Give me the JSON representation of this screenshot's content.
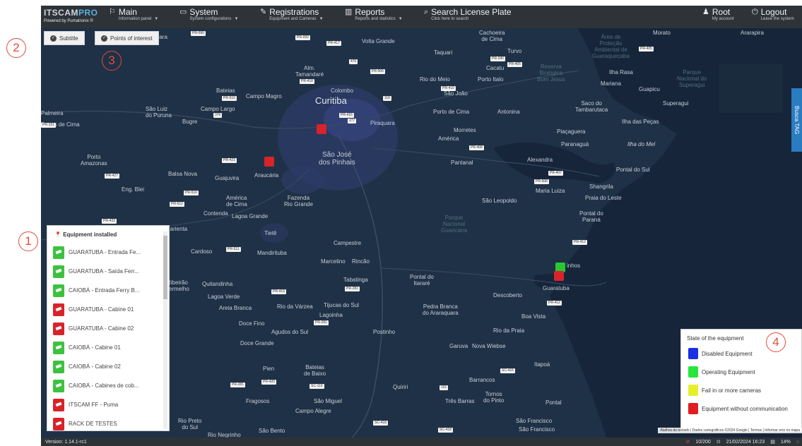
{
  "nav": {
    "brand_logo_a": "ITSCAM",
    "brand_logo_b": "PRO",
    "brand_powered": "Powered by Pumatronix ®",
    "main": {
      "title": "Main",
      "subtitle": "Information panel"
    },
    "system": {
      "title": "System",
      "subtitle": "System configurations"
    },
    "registrations": {
      "title": "Registrations",
      "subtitle": "Equipment and Cameras"
    },
    "reports": {
      "title": "Reports",
      "subtitle": "Reports and statistics"
    },
    "search": {
      "title": "Search License Plate",
      "subtitle": "Click here to search"
    },
    "account": {
      "title": "Root",
      "subtitle": "My account"
    },
    "logout": {
      "title": "Logout",
      "subtitle": "Leave the system"
    }
  },
  "map_controls": {
    "subtitle": "Subtitle",
    "points_of_interest": "Points of interest",
    "busca_tag": "Busca TAG"
  },
  "map_labels": {
    "curitiba": "Curitiba",
    "sao_jose": "São José\ndos Pinhais",
    "taquara": "Taquara",
    "colombo": "Colombo",
    "campo_magro": "Campo Magro",
    "almirante": "Alm.\nTamandaré",
    "bateias": "Bateias",
    "palmeira": "Palmeira",
    "pugas": "Pugas de Cima",
    "sao_luiz": "São Luiz\ndo Puruna",
    "campo_largo": "Campo Largo",
    "bugre": "Bugre",
    "porto_amazonas": "Porto\nAmazonas",
    "eng_blei": "Eng. Blei",
    "balsa_nova": "Balsa Nova",
    "guajuvira": "Guajuvira",
    "araucaria": "Araucária",
    "america": "América\nde Cima",
    "contenda": "Contenda",
    "lagoa_grande": "Lagoa Grande",
    "fazenda": "Fazenda\nRio Grande",
    "tiete": "Tietê",
    "mandirituba": "Mandirituba",
    "cardoso": "Cardoso",
    "campestre": "Campestre",
    "marcelino": "Marcelino",
    "rincao": "Rincão",
    "tabatinga": "Tabatinga",
    "pontal_itarare": "Pontal do\nItararé",
    "ribeirao": "Ribeirão\nVermelho",
    "quitandinha": "Quitandinha",
    "lagoa_verde": "Lagoa Verde",
    "areia_branca": "Areia Branca",
    "rio_varzea": "Rio da Várzea",
    "tijucas": "Tijucas do Sul",
    "lagoinha": "Lagoinha",
    "pedra_branca": "Pedra Branca\ndo Araraquara",
    "doce_fino": "Doce Fino",
    "agudos": "Agudos do Sul",
    "postinho": "Postinho",
    "doce_grande": "Doce Grande",
    "piraquara": "Piraquara",
    "quatro_barras": "Rio do Meio",
    "tapera": "Porto Italo",
    "cacatu": "Cacatu",
    "sao_joao": "São João",
    "porto_de_cima": "Porto de Cima",
    "antonina": "Antonina",
    "morretes": "Morretes",
    "america2": "América",
    "pantanal": "Pantanal",
    "alexandra": "Alexandra",
    "maria_luiza": "Maria Luiza",
    "sao_leopoldo": "São Leopoldo",
    "paranagua": "Paranaguá",
    "pontal_sul": "Pontal do Sul",
    "shangrila": "Shangrila",
    "praia_leste": "Praia do Leste",
    "pontal_parana": "Pontal do\nParaná",
    "guaratuba": "Guaratuba",
    "caiobá": "inhos",
    "descoberto": "Descoberto",
    "boa_vista": "Boa Vista",
    "rio_da_praia": "Rio da Praia",
    "garuva": "Garuva",
    "nova_wiebse": "Nova Wiebse",
    "itapoa": "Itapoá",
    "barrancos": "Barrancos",
    "quirin": "Quiriri",
    "pirai": "Pien",
    "bateias2": "Bateias\nde Baixo",
    "fragosos": "Fragosos",
    "sao_miguel": "São Miguel",
    "campo_alegre": "Campo Alegre",
    "tres_barras": "Três Barras",
    "tornos": "Tornos\ndo Pinto",
    "pontal": "Pontal",
    "sao_francisco": "São Francisco",
    "sao_francisco2": "São Francisco",
    "rio_preto": "Rio Preto\ndo Sul",
    "sao_bento": "São Bento",
    "rio_negrinho": "Rio Negrinho",
    "turvo": "Turvo",
    "taquari": "Taquari",
    "cachoeira": "Cachoeira\nde Cima",
    "morato": "Morato",
    "ararapira": "Ararapira",
    "volta_grande": "Volta Grande",
    "ilha_rasa": "Ilha Rasa",
    "mariana": "Mariana",
    "guapicu": "Guapicu",
    "superagui": "Superagui",
    "saco": "Saco do\nTambarutaca",
    "ilha_pecas": "Ilha das Peças",
    "piacaguera": "Piaçaguera",
    "ilha_mel": "Ilha do Mel",
    "pinhais": "Marienta",
    "park1": "Parque\nNacional\nGuaricana",
    "park2": "Parque\nNacional do\nSuperagui",
    "park3": "Área de\nProteção\nAmbiental de\nGuaraqueçaba",
    "park4": "Reserva\nBiológica\nBom Jesus"
  },
  "roads": [
    "PR-090",
    "PR-092",
    "PR-417",
    "476",
    "PR-506",
    "PR-340",
    "PR-405",
    "PR-418",
    "PR-510",
    "PR-415",
    "116",
    "PR-410",
    "PR-151",
    "376",
    "277",
    "PR-408",
    "PR-423",
    "PR-407",
    "PR-508",
    "PR-427",
    "PR-510",
    "PR-512",
    "PR-433",
    "PR-511",
    "PR-412",
    "PR-419",
    "PR-281",
    "PR-281",
    "PR-412",
    "SC-415",
    "101",
    "PR-281",
    "PR-420",
    "SC-110",
    "SC-418",
    "SC-418",
    "PR-405"
  ],
  "equipment_panel": {
    "title": "Equipment installed",
    "items": [
      {
        "label": "GUARATUBA - Entrada Fe...",
        "status": "green"
      },
      {
        "label": "GUARATUBA - Saída Ferr...",
        "status": "green"
      },
      {
        "label": "CAIOBÁ - Entrada Ferry B...",
        "status": "green"
      },
      {
        "label": "GUARATUBA - Cabine 01",
        "status": "red"
      },
      {
        "label": "GUARATUBA - Cabine 02",
        "status": "red"
      },
      {
        "label": "CAIOBÁ - Cabine 01",
        "status": "green"
      },
      {
        "label": "CAIOBÁ - Cabine 02",
        "status": "green"
      },
      {
        "label": "CAIOBÁ - Cabines de cob...",
        "status": "green"
      },
      {
        "label": "ITSCAM FF - Puma",
        "status": "red"
      },
      {
        "label": "RACK DE TESTES",
        "status": "red"
      }
    ]
  },
  "legend": {
    "title": "State of the equipment",
    "items": [
      {
        "label": "Disabled Equipment",
        "color": "#1a2fe6"
      },
      {
        "label": "Operating Equipment",
        "color": "#27e63a"
      },
      {
        "label": "Fail in or more cameras",
        "color": "#e6ef2a"
      },
      {
        "label": "Equipment without communication",
        "color": "#e11c22"
      }
    ]
  },
  "attribution": "Atalhos do teclado | Dados cartográficos ©2024 Google | Termos | Informar erro no mapa",
  "statusbar": {
    "version": "Version: 1.14.1-rc1",
    "count": "10/200",
    "datetime": "21/02/2024 16:23",
    "disk": "14%"
  },
  "annotations": [
    "1",
    "2",
    "3",
    "4"
  ]
}
